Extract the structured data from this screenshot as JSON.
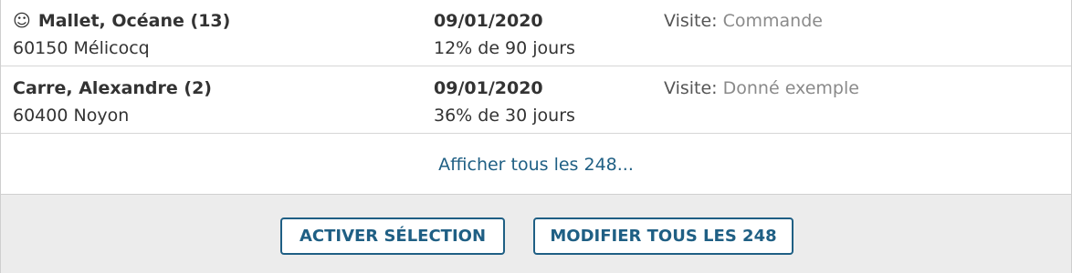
{
  "rows": [
    {
      "icon": "smiley-icon",
      "icon_glyph": "☺",
      "name": "Mallet, Océane (13)",
      "location": "60150 Mélicocq",
      "date": "09/01/2020",
      "progress": "12% de 90 jours",
      "visit_label": "Visite:",
      "visit_value": "Commande"
    },
    {
      "name": "Carre, Alexandre (2)",
      "location": "60400 Noyon",
      "date": "09/01/2020",
      "progress": "36% de 30 jours",
      "visit_label": "Visite:",
      "visit_value": "Donné exemple"
    }
  ],
  "show_all_link": "Afficher tous les 248...",
  "buttons": {
    "activate_selection": "ACTIVER SÉLECTION",
    "modify_all": "MODIFIER TOUS LES 248"
  },
  "colors": {
    "accent": "#1f5f84",
    "footer_bg": "#ececec"
  }
}
